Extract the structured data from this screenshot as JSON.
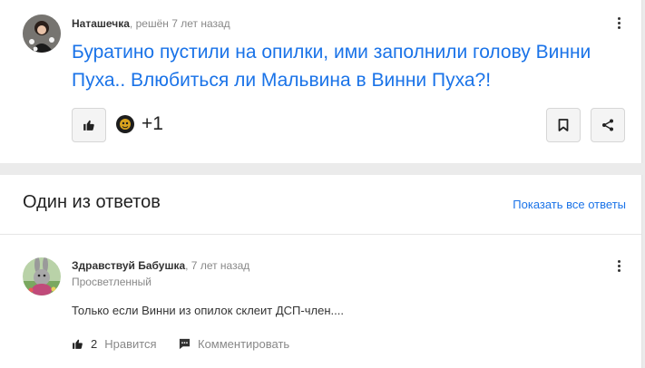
{
  "question": {
    "author": "Наташечка",
    "meta": ", решён 7 лет назад",
    "title": "Буратино пустили на опилки, ими заполнили голову Винни Пуха.. Влюбиться ли Мальвина в Винни Пуха?!",
    "reactions_count": "+1",
    "icons": [
      "avatar",
      "more-vertical-icon",
      "thumb-up-icon",
      "reaction-avatar",
      "bookmark-icon",
      "share-icon"
    ]
  },
  "answers_section": {
    "title": "Один из ответов",
    "show_all": "Показать все ответы"
  },
  "answer": {
    "author": "Здравствуй Бабушка",
    "meta": ", 7 лет назад",
    "rank": "Просветленный",
    "text": "Только если Винни из опилок склеит ДСП-член....",
    "likes": "2",
    "like_label": "Нравится",
    "comment_label": "Комментировать"
  },
  "colors": {
    "accent": "#1a73e8",
    "background": "#ebebeb",
    "card": "#ffffff"
  }
}
